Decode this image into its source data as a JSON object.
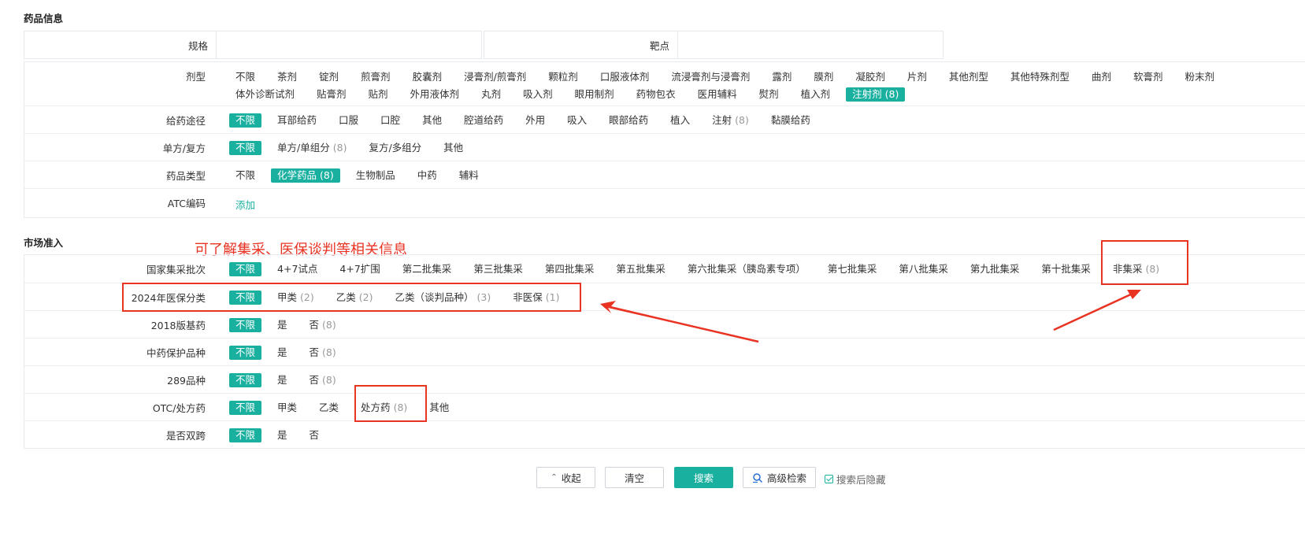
{
  "drug_info": {
    "title": "药品信息",
    "spec_label": "规格",
    "target_label": "靶点",
    "dosage": {
      "label": "剂型",
      "line1": [
        "不限",
        "茶剂",
        "锭剂",
        "煎膏剂",
        "胶囊剂",
        "浸膏剂/煎膏剂",
        "颗粒剂",
        "口服液体剂",
        "流浸膏剂与浸膏剂",
        "露剂",
        "膜剂",
        "凝胶剂",
        "片剂",
        "其他剂型",
        "其他特殊剂型",
        "曲剂",
        "软膏剂",
        "粉末剂"
      ],
      "line2": [
        "体外诊断试剂",
        "贴膏剂",
        "贴剂",
        "外用液体剂",
        "丸剂",
        "吸入剂",
        "眼用制剂",
        "药物包衣",
        "医用辅料",
        "熨剂",
        "植入剂"
      ],
      "active": "注射剂 (8)"
    },
    "route": {
      "label": "给药途径",
      "active": "不限",
      "options": [
        "耳部给药",
        "口服",
        "口腔",
        "其他",
        "腔道给药",
        "外用",
        "吸入",
        "眼部给药",
        "植入"
      ],
      "inject": "注射",
      "inject_count": "(8)",
      "last": "黏膜给药"
    },
    "single": {
      "label": "单方/复方",
      "active": "不限",
      "opt1": "单方/单组分",
      "opt1_count": "(8)",
      "opt2": "复方/多组分",
      "opt3": "其他"
    },
    "drug_type": {
      "label": "药品类型",
      "opt0": "不限",
      "active": "化学药品 (8)",
      "opt1": "生物制品",
      "opt2": "中药",
      "opt3": "辅料"
    },
    "atc": {
      "label": "ATC编码",
      "add": "添加"
    }
  },
  "market": {
    "title": "市场准入",
    "annotation": "可了解集采、医保谈判等相关信息",
    "batch": {
      "label": "国家集采批次",
      "active": "不限",
      "options": [
        "4+7试点",
        "4+7扩围",
        "第二批集采",
        "第三批集采",
        "第四批集采",
        "第五批集采",
        "第六批集采（胰岛素专项）",
        "第七批集采",
        "第八批集采",
        "第九批集采",
        "第十批集采"
      ],
      "non": "非集采",
      "non_count": "(8)"
    },
    "insurance": {
      "label": "2024年医保分类",
      "active": "不限",
      "a": "甲类",
      "a_count": "(2)",
      "b": "乙类",
      "b_count": "(2)",
      "bn": "乙类（谈判品种）",
      "bn_count": "(3)",
      "non": "非医保",
      "non_count": "(1)"
    },
    "essential": {
      "label": "2018版基药",
      "active": "不限",
      "yes": "是",
      "no": "否",
      "no_count": "(8)"
    },
    "tcm": {
      "label": "中药保护品种",
      "active": "不限",
      "yes": "是",
      "no": "否",
      "no_count": "(8)"
    },
    "v289": {
      "label": "289品种",
      "active": "不限",
      "yes": "是",
      "no": "否",
      "no_count": "(8)"
    },
    "otc": {
      "label": "OTC/处方药",
      "active": "不限",
      "a": "甲类",
      "b": "乙类",
      "rx": "处方药",
      "rx_count": "(8)",
      "other": "其他"
    },
    "dual": {
      "label": "是否双跨",
      "active": "不限",
      "yes": "是",
      "no": "否"
    }
  },
  "actions": {
    "collapse": "收起",
    "clear": "清空",
    "search": "搜索",
    "advanced": "高级检索",
    "hide_after": "搜索后隐藏"
  },
  "colors": {
    "accent": "#1ab0a0",
    "annotation": "#e93323"
  }
}
